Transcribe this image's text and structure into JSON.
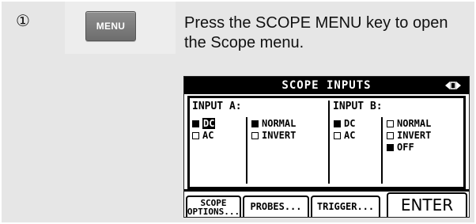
{
  "step": {
    "number": "①"
  },
  "key": {
    "label": "MENU"
  },
  "instruction": "Press the SCOPE MENU key to open the Scope menu.",
  "lcd": {
    "title": "SCOPE INPUTS",
    "nav_icon": "left-right-arrows-icon",
    "input_a": {
      "label": "INPUT A:",
      "coupling": [
        {
          "label": "DC",
          "selected": true
        },
        {
          "label": "AC",
          "selected": false
        }
      ],
      "polarity": [
        {
          "label": "NORMAL",
          "selected": true
        },
        {
          "label": "INVERT",
          "selected": false
        }
      ]
    },
    "input_b": {
      "label": "INPUT B:",
      "coupling": [
        {
          "label": "DC",
          "selected": true
        },
        {
          "label": "AC",
          "selected": false
        }
      ],
      "polarity": [
        {
          "label": "NORMAL",
          "selected": false
        },
        {
          "label": "INVERT",
          "selected": false
        },
        {
          "label": "OFF",
          "selected": true
        }
      ]
    },
    "softkeys": {
      "scope_options_line1": "SCOPE",
      "scope_options_line2": "OPTIONS...",
      "probes": "PROBES...",
      "trigger": "TRIGGER...",
      "enter": "ENTER"
    }
  }
}
